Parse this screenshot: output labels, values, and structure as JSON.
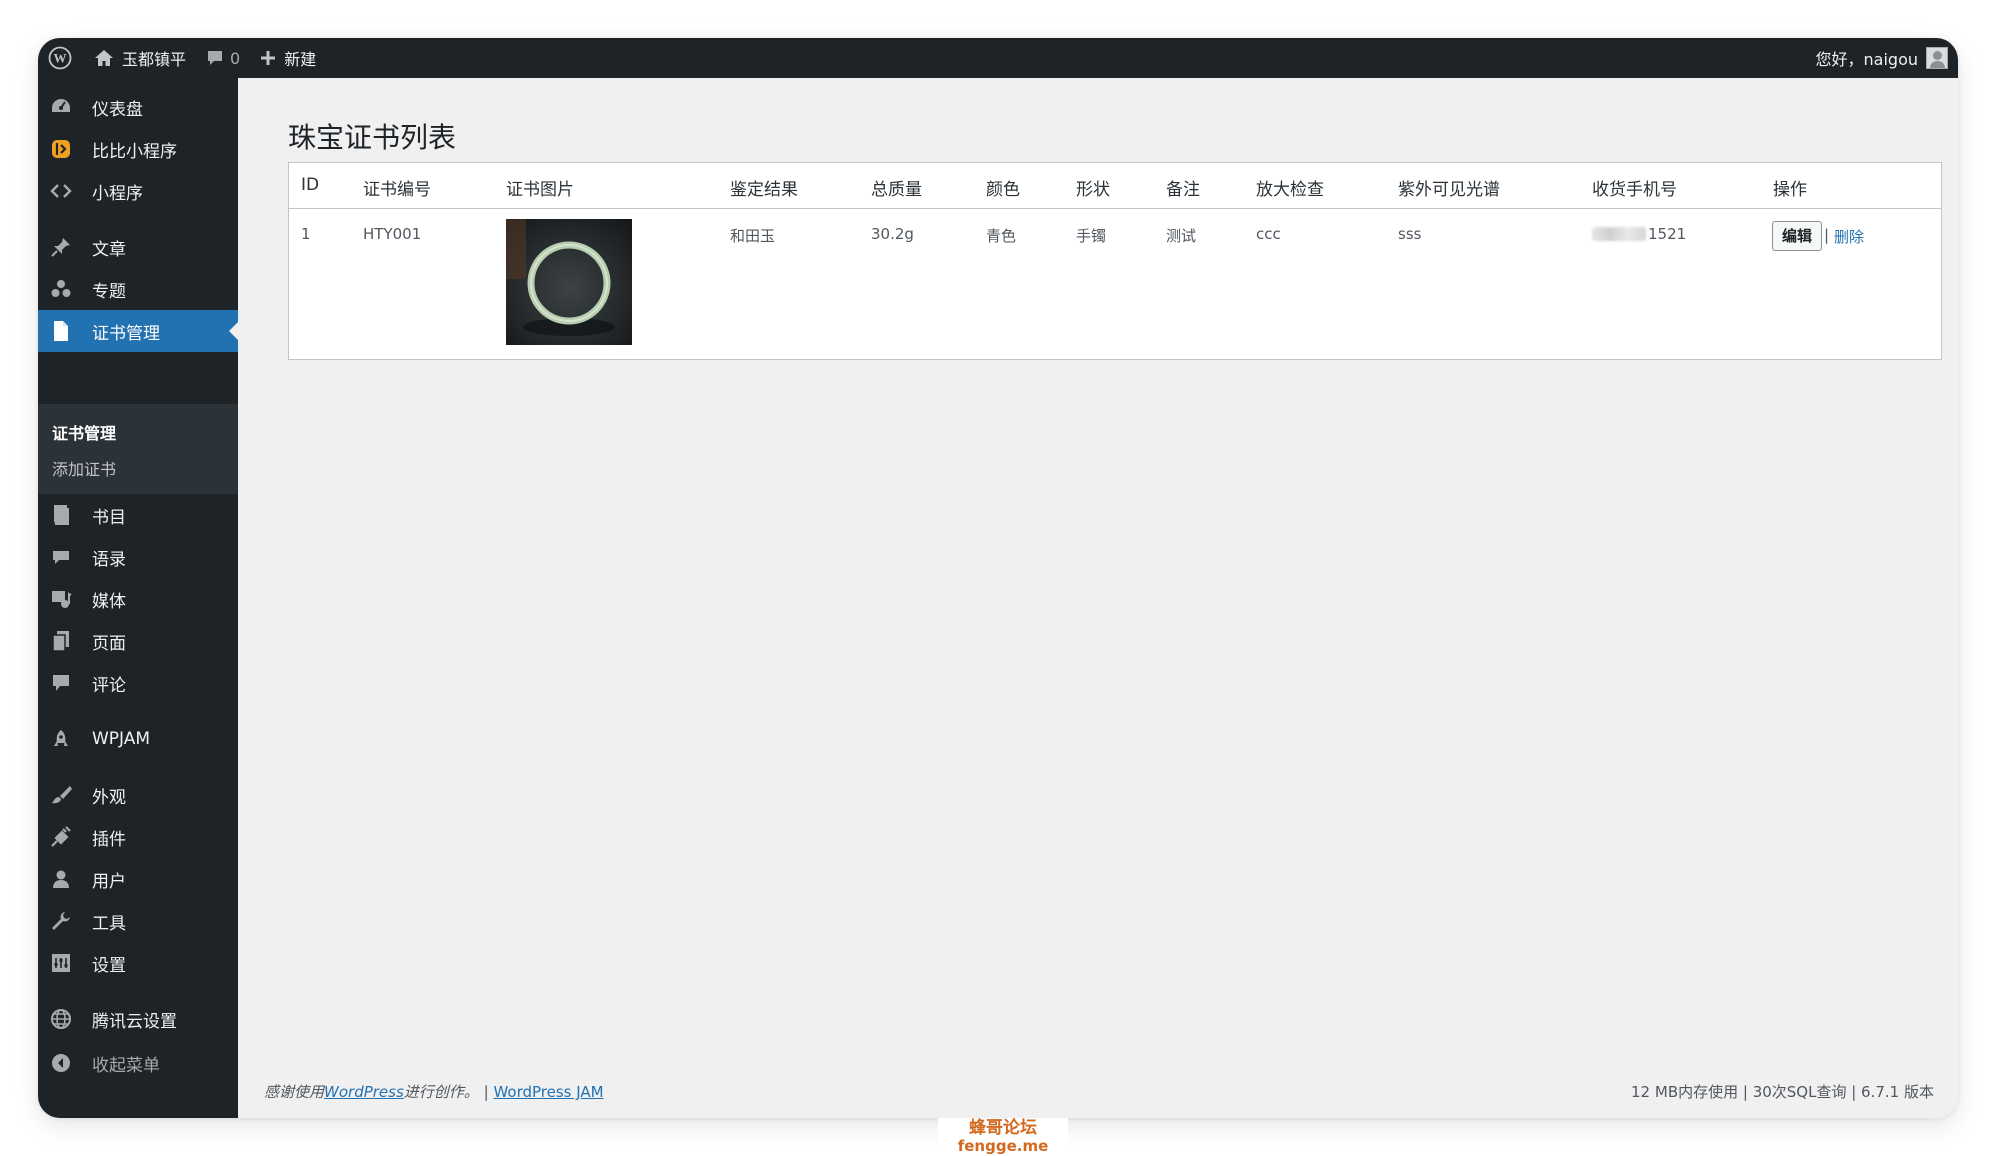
{
  "adminbar": {
    "site_name": "玉都镇平",
    "comments_count": "0",
    "new_label": "新建",
    "greeting": "您好，naigou"
  },
  "sidebar": {
    "items": [
      {
        "label": "仪表盘",
        "icon": "dashboard-icon"
      },
      {
        "label": "比比小程序",
        "icon": "bibi-miniprogram-icon"
      },
      {
        "label": "小程序",
        "icon": "code-icon"
      },
      {
        "label": "文章",
        "icon": "pin-icon"
      },
      {
        "label": "专题",
        "icon": "groups-icon"
      },
      {
        "label": "证书管理",
        "icon": "page-icon"
      },
      {
        "label": "书目",
        "icon": "book-icon"
      },
      {
        "label": "语录",
        "icon": "quote-icon"
      },
      {
        "label": "媒体",
        "icon": "media-icon"
      },
      {
        "label": "页面",
        "icon": "pages-icon"
      },
      {
        "label": "评论",
        "icon": "comment-icon"
      },
      {
        "label": "WPJAM",
        "icon": "rocket-icon"
      },
      {
        "label": "外观",
        "icon": "brush-icon"
      },
      {
        "label": "插件",
        "icon": "plugin-icon"
      },
      {
        "label": "用户",
        "icon": "user-icon"
      },
      {
        "label": "工具",
        "icon": "wrench-icon"
      },
      {
        "label": "设置",
        "icon": "settings-icon"
      },
      {
        "label": "腾讯云设置",
        "icon": "globe-icon"
      },
      {
        "label": "收起菜单",
        "icon": "collapse-icon"
      }
    ],
    "submenu": [
      "证书管理",
      "添加证书"
    ],
    "accent": "#2271b1"
  },
  "page": {
    "title": "珠宝证书列表",
    "columns": [
      "ID",
      "证书编号",
      "证书图片",
      "鉴定结果",
      "总质量",
      "颜色",
      "形状",
      "备注",
      "放大检查",
      "紫外可见光谱",
      "收货手机号",
      "操作"
    ],
    "rows": [
      {
        "id": "1",
        "cert_no": "HTY001",
        "image": "jade-bangle-photo",
        "result": "和田玉",
        "weight": "30.2g",
        "color": "青色",
        "shape": "手镯",
        "note": "测试",
        "magnify": "ccc",
        "spectrum": "sss",
        "phone_visible": "1521",
        "edit_label": "编辑",
        "sep": "|",
        "delete_label": "删除"
      }
    ]
  },
  "footer": {
    "thanks_prefix": "感谢使用",
    "wp_link": "WordPress",
    "thanks_suffix": "进行创作。",
    "sep": "|",
    "jam_link": "WordPress JAM",
    "stats": "12 MB内存使用 | 30次SQL查询 | 6.7.1 版本"
  },
  "watermark": {
    "line1": "蜂哥论坛",
    "line2": "fengge.me"
  }
}
